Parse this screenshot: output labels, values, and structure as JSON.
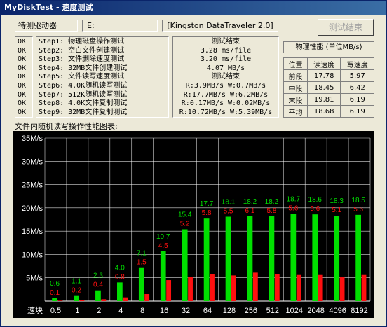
{
  "window": {
    "title": "MyDiskTest - 速度测试"
  },
  "drive": {
    "label": "待测驱动器",
    "letter": "E:",
    "name": "[Kingston DataTraveler 2.0]"
  },
  "end_button": "测试结束",
  "steps": [
    {
      "status": "OK",
      "text": "Step1: 物理磁盘操作测试"
    },
    {
      "status": "OK",
      "text": "Step2: 空白文件创建测试"
    },
    {
      "status": "OK",
      "text": "Step3: 文件删除速度测试"
    },
    {
      "status": "OK",
      "text": "Step4: 32MB文件创建测试"
    },
    {
      "status": "OK",
      "text": "Step5: 文件读写速度测试"
    },
    {
      "status": "OK",
      "text": "Step6: 4.0K随机读写测试"
    },
    {
      "status": "OK",
      "text": "Step7: 512K随机读写测试"
    },
    {
      "status": "OK",
      "text": "Step8: 4.0K文件复制测试"
    },
    {
      "status": "OK",
      "text": "Step9: 32MB文件复制测试"
    }
  ],
  "results": [
    "测试结束",
    "3.28 ms/file",
    "3.20 ms/file",
    "4.07 MB/s",
    "测试结束",
    "R:3.9MB/s W:0.7MB/s",
    "R:17.7MB/s W:6.2MB/s",
    "R:0.17MB/s W:0.02MB/s",
    "R:10.72MB/s W:5.39MB/s"
  ],
  "performance": {
    "title": "物理性能 (单位MB/s)",
    "headers": [
      "位置",
      "读速度",
      "写速度"
    ],
    "rows": [
      [
        "前段",
        "17.78",
        "5.97"
      ],
      [
        "中段",
        "18.45",
        "6.42"
      ],
      [
        "末段",
        "19.81",
        "6.19"
      ],
      [
        "平均",
        "18.68",
        "6.19"
      ]
    ]
  },
  "chart_label": "文件内随机读写操作性能图表:",
  "colors": {
    "read": "#00e000",
    "write": "#ff1010",
    "grid": "#ffffff",
    "text": "#ffffff"
  },
  "chart_data": {
    "type": "bar",
    "title": "",
    "xlabel": "",
    "ylabel": "",
    "ylim": [
      0,
      35
    ],
    "y_tick_labels": [
      "5M/s",
      "10M/s",
      "15M/s",
      "20M/s",
      "25M/s",
      "30M/s",
      "35M/s"
    ],
    "first_tick_label": "速块",
    "categories": [
      "0.5",
      "1",
      "2",
      "4",
      "8",
      "16",
      "32",
      "64",
      "128",
      "256",
      "512",
      "1024",
      "2048",
      "4096",
      "8192"
    ],
    "series": [
      {
        "values": [
          0.6,
          1.1,
          2.3,
          4.0,
          7.1,
          10.7,
          15.4,
          17.7,
          18.1,
          18.2,
          18.2,
          18.7,
          18.6,
          18.3,
          18.5
        ]
      },
      {
        "values": [
          0.1,
          0.2,
          0.4,
          0.8,
          1.5,
          4.5,
          5.2,
          5.8,
          5.5,
          6.1,
          5.8,
          5.6,
          5.6,
          5.1,
          5.6
        ]
      }
    ],
    "read_labels": [
      "0.6",
      "1.1",
      "2.3",
      "4.0",
      "7.1",
      "10.7",
      "15.4",
      "17.7",
      "18.1",
      "18.2",
      "18.2",
      "18.7",
      "18.6",
      "18.3",
      "18.5"
    ],
    "write_labels": [
      "0.1",
      "0.2",
      "0.4",
      "0.8",
      "1.5",
      "4.5",
      "5.2",
      "5.8",
      "5.5",
      "6.1",
      "5.8",
      "5.6",
      "5.6",
      "5.1",
      "5.6"
    ],
    "grid": true
  }
}
